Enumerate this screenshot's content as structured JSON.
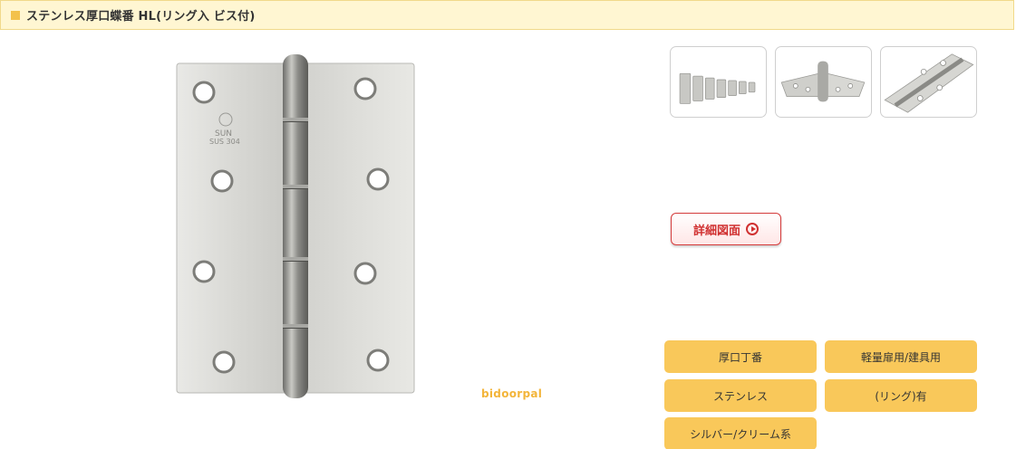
{
  "header": {
    "title": "ステンレス厚口蝶番 HL(リング入 ビス付)",
    "accent_color": "#f3c14b"
  },
  "main_image": {
    "stamp_brand": "SUN",
    "stamp_material": "SUS 304",
    "icon": "hinge-image"
  },
  "watermark": "bidoorpal",
  "thumbnails": [
    {
      "icon": "hinge-set-thumbnail"
    },
    {
      "icon": "hinge-open-thumbnail"
    },
    {
      "icon": "hinge-closeup-thumbnail"
    }
  ],
  "detail_button": {
    "label": "詳細図面",
    "color": "#d03030",
    "icon": "play-circle-icon"
  },
  "tags": [
    {
      "label": "厚口丁番"
    },
    {
      "label": "軽量扉用/建具用"
    },
    {
      "label": "ステンレス"
    },
    {
      "label": "(リング)有"
    },
    {
      "label": "シルバー/クリーム系"
    }
  ],
  "tag_color": "#f9c85a"
}
